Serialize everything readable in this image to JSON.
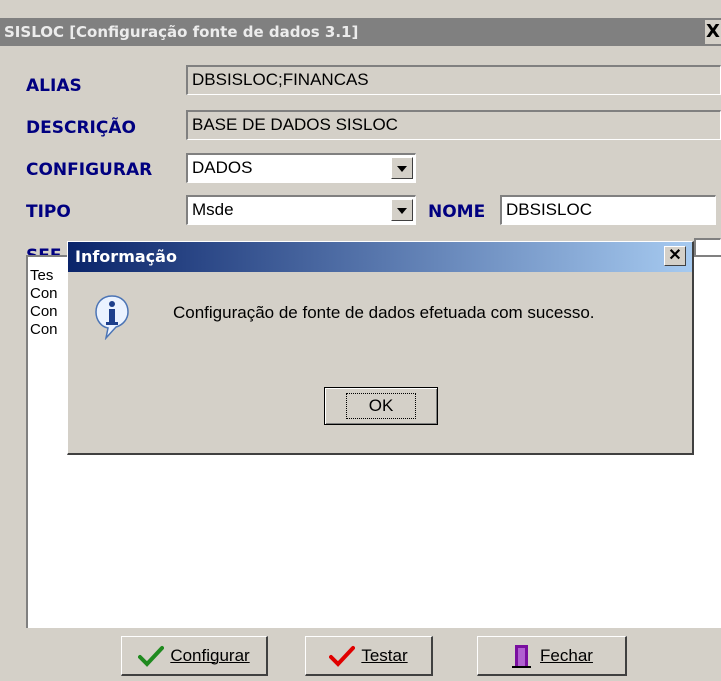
{
  "window": {
    "title": "SISLOC [Configuração fonte de dados 3.1]",
    "close_glyph": "X"
  },
  "form": {
    "alias_label": "ALIAS",
    "alias_value": "DBSISLOC;FINANCAS",
    "descricao_label": "DESCRIÇÃO",
    "descricao_value": "BASE DE DADOS SISLOC",
    "configurar_label": "CONFIGURAR",
    "configurar_value": "DADOS",
    "tipo_label": "TIPO",
    "tipo_value": "Msde",
    "nome_label": "NOME",
    "nome_value": "DBSISLOC",
    "servidor_label_visible": "SEF"
  },
  "log_lines": [
    "Tes",
    "Con",
    "Con",
    "Con"
  ],
  "buttons": {
    "configurar": "Configurar",
    "testar": "Testar",
    "fechar": "Fechar"
  },
  "dialog": {
    "title": "Informação",
    "message": "Configuração de fonte de dados efetuada com sucesso.",
    "ok_label": "OK",
    "icon": "information-icon"
  },
  "colors": {
    "label": "#000080",
    "dialog_title_start": "#0a246a",
    "dialog_title_end": "#a6caf0"
  }
}
